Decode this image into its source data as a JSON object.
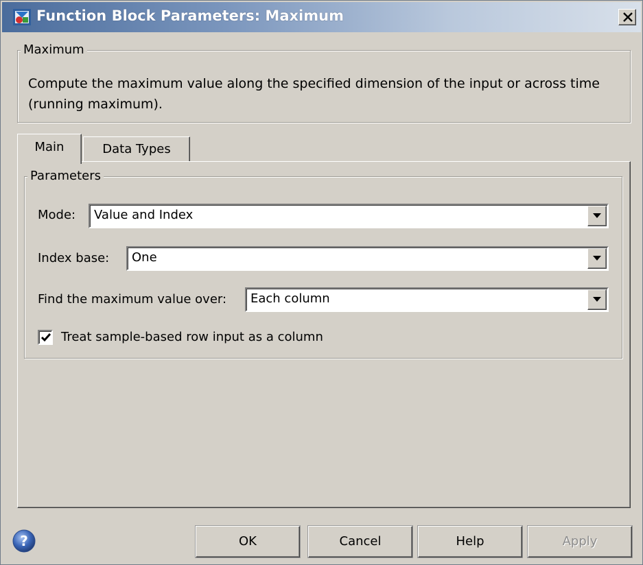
{
  "window": {
    "title": "Function Block Parameters: Maximum"
  },
  "description_group": {
    "legend": "Maximum",
    "text": "Compute the maximum value along the specified dimension of the input or across time (running maximum)."
  },
  "tabs": [
    {
      "label": "Main",
      "active": true
    },
    {
      "label": "Data Types",
      "active": false
    }
  ],
  "parameters": {
    "legend": "Parameters",
    "mode": {
      "label": "Mode:",
      "value": "Value and Index"
    },
    "index_base": {
      "label": "Index base:",
      "value": "One"
    },
    "find_over": {
      "label": "Find the maximum value over:",
      "value": "Each column"
    },
    "treat_row": {
      "label": "Treat sample-based row input as a column",
      "checked": true
    }
  },
  "buttons": {
    "ok": "OK",
    "cancel": "Cancel",
    "help": "Help",
    "apply": "Apply"
  },
  "icons": {
    "title": "simulink-block-icon",
    "close": "close-icon",
    "help": "question-mark-icon",
    "dropdown": "chevron-down-icon"
  },
  "colors": {
    "titlebar_start": "#4a6c9c",
    "face": "#d4d0c8",
    "help_blue": "#3b66b8"
  }
}
